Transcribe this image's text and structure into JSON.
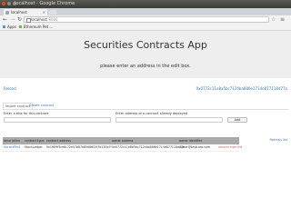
{
  "os": {
    "window_title": "localhost - Google Chrome"
  },
  "browser": {
    "tab_title": "localhost",
    "url_host": "localhost",
    "url_path": ":8080",
    "bookmarks": [
      {
        "label": "Apps"
      },
      {
        "label": "Ethereum Pet ..."
      }
    ]
  },
  "app": {
    "title": "Securities Contracts App",
    "subtitle": "please enter an address in the edit box.",
    "reload_link": "Reload",
    "account_address": "0x0772c11e8a5bc7124ba886e1714e877118d77a",
    "tabs": [
      {
        "label": "Import contract",
        "active": true
      },
      {
        "label": "Create contract",
        "active": false
      }
    ],
    "form": {
      "title_label": "Enter a title for this contract",
      "address_label": "Enter address of a contract already deployed",
      "add_button": "Add"
    },
    "refresh_link": "Refresh list",
    "table": {
      "columns": [
        "description",
        "contract type",
        "contract address",
        "owner address",
        "owner identifier"
      ],
      "rows": [
        {
          "description": "SecondTest",
          "contract_type": "StockLedger",
          "contract_address": "0x1f6f9f5ce8c72e57b87a85d86f297b150b7f",
          "owner_address": "0x0772c11e8a5bc7124ba886e1714e877118d77a",
          "owner_identifier": "owner@testcorp.com",
          "action": "remove from list"
        }
      ]
    }
  }
}
